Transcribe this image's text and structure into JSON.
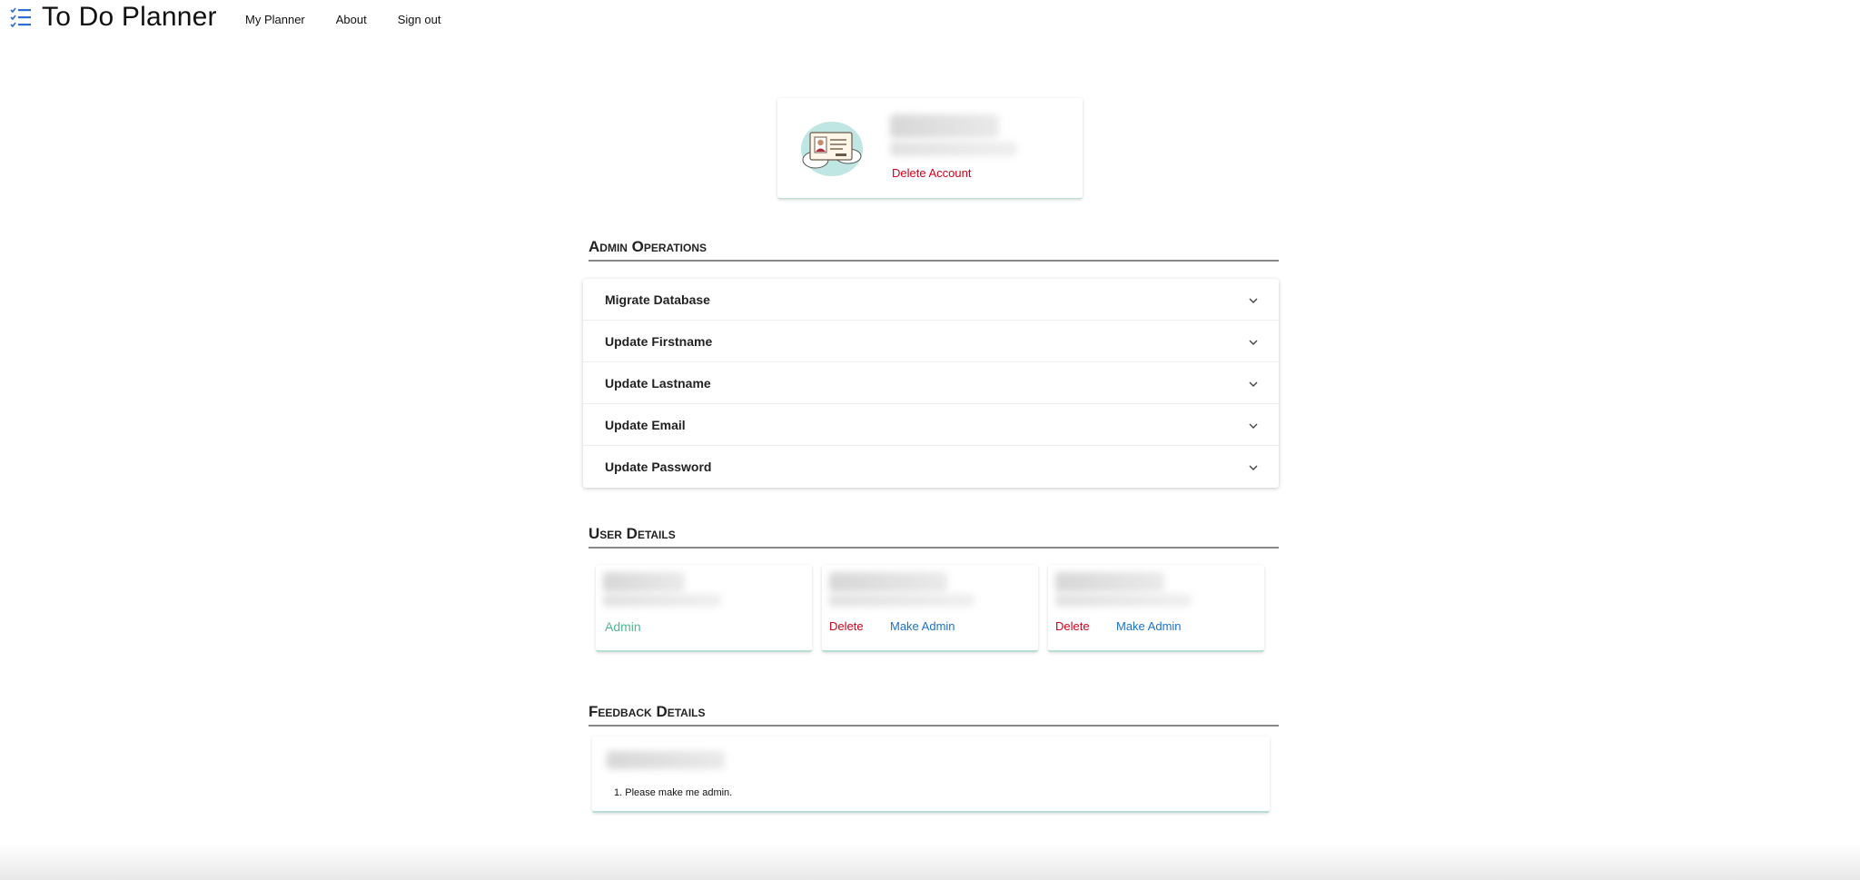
{
  "app": {
    "title": "To Do Planner",
    "icon": "checklist-icon",
    "nav": [
      {
        "label": "My Planner"
      },
      {
        "label": "About"
      },
      {
        "label": "Sign out"
      }
    ]
  },
  "profile": {
    "avatar_icon": "id-card-cloud-icon",
    "delete_account_label": "Delete Account"
  },
  "admin_operations": {
    "title": "Admin Operations",
    "items": [
      {
        "label": "Migrate Database"
      },
      {
        "label": "Update Firstname"
      },
      {
        "label": "Update Lastname"
      },
      {
        "label": "Update Email"
      },
      {
        "label": "Update Password"
      }
    ]
  },
  "user_details": {
    "title": "User Details",
    "users": [
      {
        "role_label": "Admin"
      },
      {
        "delete_label": "Delete",
        "make_admin_label": "Make Admin"
      },
      {
        "delete_label": "Delete",
        "make_admin_label": "Make Admin"
      }
    ]
  },
  "feedback_details": {
    "title": "Feedback Details",
    "items": [
      {
        "text": "1. Please make me admin."
      }
    ]
  },
  "colors": {
    "danger": "#d0021b",
    "link": "#1a73c9",
    "admin": "#4dbb8f",
    "brand_icon": "#2a6fd1",
    "card_border": "#b8ddd4"
  }
}
